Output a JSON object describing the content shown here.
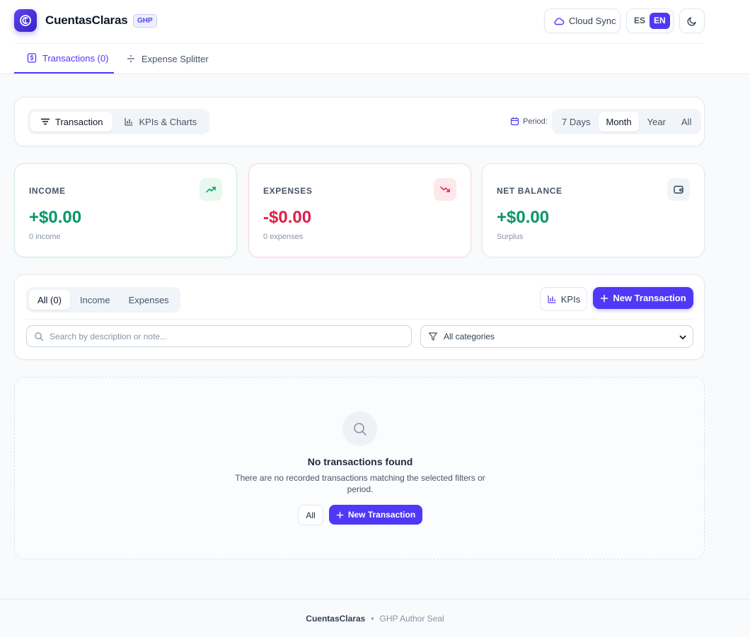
{
  "header": {
    "brand": "CuentasClaras",
    "badge": "GHP",
    "cloud_sync": "Cloud Sync",
    "lang": {
      "es": "ES",
      "en": "EN",
      "active": "EN"
    },
    "icons": {
      "logo": "logo-icon",
      "cloud": "cloud-icon",
      "theme": "moon-icon"
    }
  },
  "nav": {
    "tabs": [
      {
        "label": "Transactions (0)",
        "active": true,
        "icon": "dollar-doc-icon"
      },
      {
        "label": "Expense Splitter",
        "active": false,
        "icon": "divide-icon"
      }
    ]
  },
  "toolbar": {
    "view_tabs": [
      {
        "label": "Transaction",
        "active": true,
        "icon": "filter-lines-icon"
      },
      {
        "label": "KPIs & Charts",
        "active": false,
        "icon": "bar-chart-icon"
      }
    ],
    "period_label": "Period:",
    "periods": [
      {
        "label": "7 Days",
        "active": false
      },
      {
        "label": "Month",
        "active": true
      },
      {
        "label": "Year",
        "active": false
      },
      {
        "label": "All",
        "active": false
      }
    ]
  },
  "stats": {
    "income": {
      "label": "INCOME",
      "value": "+$0.00",
      "sub": "0 income",
      "icon": "trending-up-icon"
    },
    "expenses": {
      "label": "EXPENSES",
      "value": "-$0.00",
      "sub": "0 expenses",
      "icon": "trending-down-icon"
    },
    "net": {
      "label": "NET BALANCE",
      "value": "+$0.00",
      "sub": "Surplus",
      "icon": "wallet-icon"
    }
  },
  "filters": {
    "types": [
      {
        "label": "All (0)",
        "active": true
      },
      {
        "label": "Income",
        "active": false
      },
      {
        "label": "Expenses",
        "active": false
      }
    ],
    "kpis_label": "KPIs",
    "new_label": "New Transaction",
    "search_placeholder": "Search by description or note...",
    "search_value": "",
    "category_selected": "All categories"
  },
  "empty": {
    "title": "No transactions found",
    "desc": "There are no recorded transactions matching the selected filters or period.",
    "all_label": "All",
    "new_label": "New Transaction"
  },
  "footer": {
    "brand": "CuentasClaras",
    "sep": "•",
    "seal": "GHP Author Seal"
  },
  "colors": {
    "accent": "#4f39f6",
    "income": "#059669",
    "expense": "#e11d48"
  }
}
